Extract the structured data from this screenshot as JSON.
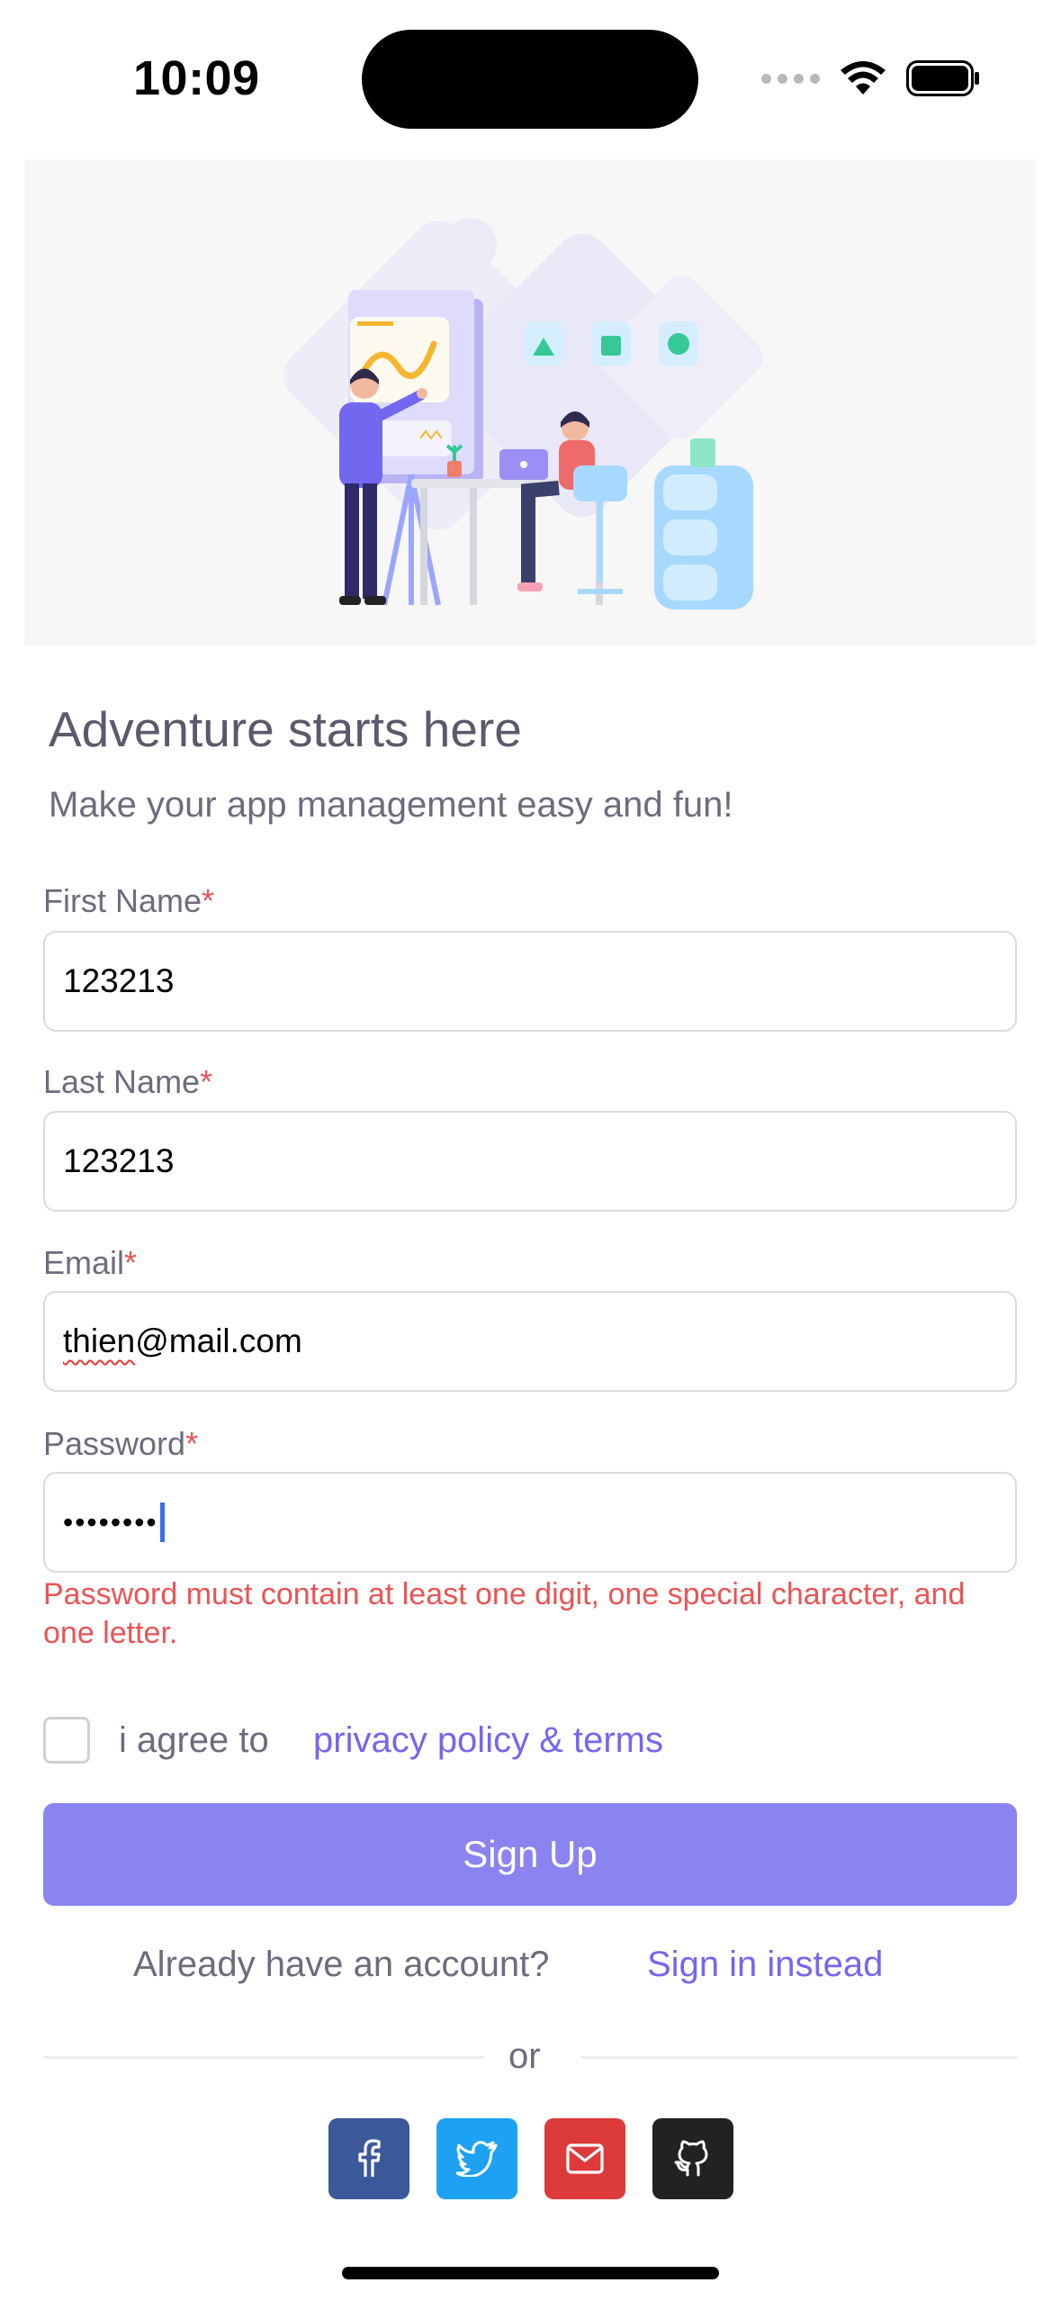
{
  "status_bar": {
    "time": "10:09"
  },
  "hero": {
    "illustration": "team-working-illustration"
  },
  "heading": {
    "title": "Adventure starts here",
    "subtitle": "Make your app management easy and fun!"
  },
  "form": {
    "first_name": {
      "label": "First Name",
      "required_mark": "*",
      "value": "123213"
    },
    "last_name": {
      "label": "Last Name",
      "required_mark": "*",
      "value": "123213"
    },
    "email": {
      "label": "Email",
      "required_mark": "*",
      "value_underlined": "thien",
      "value_rest": "@mail.com"
    },
    "password": {
      "label": "Password",
      "required_mark": "*",
      "masked_value": "••••••••",
      "length": 8
    },
    "password_error": "Password must contain at least one digit, one special character, and one letter.",
    "agree_text": "i agree to",
    "agree_link": "privacy policy & terms",
    "agree_checked": false,
    "submit_label": "Sign Up"
  },
  "footer": {
    "already_text": "Already have an account?",
    "signin_link": "Sign in instead",
    "divider_text": "or",
    "social": [
      {
        "name": "facebook-icon",
        "color": "#3b5998"
      },
      {
        "name": "twitter-icon",
        "color": "#1da1f2"
      },
      {
        "name": "mail-icon",
        "color": "#dd3a3a"
      },
      {
        "name": "github-icon",
        "color": "#222222"
      }
    ]
  },
  "theme": {
    "primary": "#7367f0",
    "button": "#8a84f0",
    "error": "#ea5455"
  }
}
